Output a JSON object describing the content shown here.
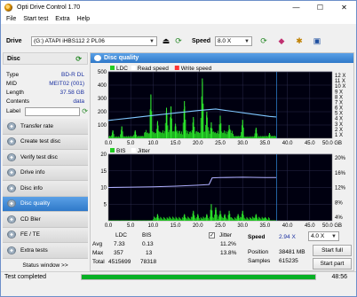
{
  "window": {
    "title": "Opti Drive Control 1.70",
    "min": "—",
    "max": "☐",
    "close": "✕"
  },
  "menu": [
    "File",
    "Start test",
    "Extra",
    "Help"
  ],
  "toolbar": {
    "drive_label": "Drive",
    "drive_value": "(G:)  ATAPI iHBS112  2 PL06",
    "speed_label": "Speed",
    "speed_value": "8.0 X"
  },
  "disc": {
    "title": "Disc",
    "rows": [
      {
        "key": "Type",
        "value": "BD-R DL"
      },
      {
        "key": "MID",
        "value": "MEIT02 (001)"
      },
      {
        "key": "Length",
        "value": "37.58 GB"
      },
      {
        "key": "Contents",
        "value": "data"
      }
    ],
    "label_key": "Label"
  },
  "nav": [
    {
      "label": "Transfer rate",
      "active": false
    },
    {
      "label": "Create test disc",
      "active": false
    },
    {
      "label": "Verify test disc",
      "active": false
    },
    {
      "label": "Drive info",
      "active": false
    },
    {
      "label": "Disc info",
      "active": false
    },
    {
      "label": "Disc quality",
      "active": true
    },
    {
      "label": "CD Bler",
      "active": false
    },
    {
      "label": "FE / TE",
      "active": false
    },
    {
      "label": "Extra tests",
      "active": false
    }
  ],
  "status_window": "Status window >>",
  "panel_title": "Disc quality",
  "chart_data": [
    {
      "type": "bar",
      "legend": [
        "LDC",
        "Read speed",
        "Write speed"
      ],
      "x_ticks": [
        "0.0",
        "5.0",
        "10.0",
        "15.0",
        "20.0",
        "25.0",
        "30.0",
        "35.0",
        "40.0",
        "45.0",
        "50.0 GB"
      ],
      "y_left_ticks": [
        "500",
        "400",
        "300",
        "200",
        "100"
      ],
      "y_right_ticks": [
        "12 X",
        "11 X",
        "10 X",
        "9 X",
        "8 X",
        "7 X",
        "6 X",
        "5 X",
        "4 X",
        "3 X",
        "2 X",
        "1 X"
      ],
      "xlim": [
        0,
        50
      ],
      "ylim": [
        0,
        500
      ],
      "ldc_peaks": [
        [
          1,
          60
        ],
        [
          3,
          90
        ],
        [
          6,
          60
        ],
        [
          9.5,
          330
        ],
        [
          11,
          130
        ],
        [
          13,
          230
        ],
        [
          14,
          240
        ],
        [
          15,
          110
        ],
        [
          17,
          280
        ],
        [
          19,
          160
        ],
        [
          21,
          450
        ],
        [
          22,
          200
        ],
        [
          23,
          120
        ],
        [
          25,
          170
        ],
        [
          27,
          100
        ],
        [
          30,
          140
        ],
        [
          33,
          80
        ],
        [
          36,
          40
        ]
      ],
      "read_speed": [
        [
          0,
          2.9
        ],
        [
          5,
          3.4
        ],
        [
          10,
          3.9
        ],
        [
          15,
          4.4
        ],
        [
          20,
          4.9
        ],
        [
          24,
          5.2
        ],
        [
          28,
          4.7
        ],
        [
          32,
          4.2
        ],
        [
          36,
          3.7
        ],
        [
          37.5,
          3.6
        ]
      ]
    },
    {
      "type": "bar",
      "legend": [
        "BIS",
        "Jitter"
      ],
      "x_ticks": [
        "0.0",
        "5.0",
        "10.0",
        "15.0",
        "20.0",
        "25.0",
        "30.0",
        "35.0",
        "40.0",
        "45.0",
        "50.0 GB"
      ],
      "y_left_ticks": [
        "20",
        "15",
        "10",
        "5"
      ],
      "y_right_ticks": [
        "20%",
        "16%",
        "12%",
        "8%",
        "4%"
      ],
      "xlim": [
        0,
        50
      ],
      "ylim": [
        0,
        20
      ],
      "bis_peaks": [
        [
          11,
          2
        ],
        [
          17,
          2
        ],
        [
          19,
          3
        ],
        [
          20,
          2
        ],
        [
          22,
          2
        ],
        [
          23,
          5
        ],
        [
          24,
          4
        ],
        [
          25,
          3
        ],
        [
          26,
          2
        ],
        [
          27,
          3
        ],
        [
          29,
          2
        ],
        [
          30,
          3
        ],
        [
          33,
          2
        ],
        [
          35,
          1
        ]
      ],
      "jitter": [
        [
          0,
          10.0
        ],
        [
          5,
          10.1
        ],
        [
          10,
          10.2
        ],
        [
          15,
          10.4
        ],
        [
          20,
          10.7
        ],
        [
          22.5,
          10.9
        ],
        [
          23.2,
          12.9
        ],
        [
          25,
          13.0
        ],
        [
          30,
          13.1
        ],
        [
          35,
          13.0
        ],
        [
          37.5,
          13.0
        ]
      ]
    }
  ],
  "stats": {
    "col_ldc": "LDC",
    "col_bis": "BIS",
    "avg_label": "Avg",
    "avg_ldc": "7.33",
    "avg_bis": "0.13",
    "max_label": "Max",
    "max_ldc": "357",
    "max_bis": "13",
    "total_label": "Total",
    "total_ldc": "4515699",
    "total_bis": "78318",
    "jitter_label": "Jitter",
    "jitter_check": "✓",
    "jitter_avg": "11.2%",
    "jitter_max": "13.8%",
    "speed_label": "Speed",
    "speed_value": "2.94 X",
    "speed_select": "4.0 X",
    "position_label": "Position",
    "position_value": "38481 MB",
    "samples_label": "Samples",
    "samples_value": "615235",
    "start_full": "Start full",
    "start_part": "Start part"
  },
  "statusbar": {
    "text": "Test completed",
    "progress": 1.0,
    "time": "48:56"
  }
}
